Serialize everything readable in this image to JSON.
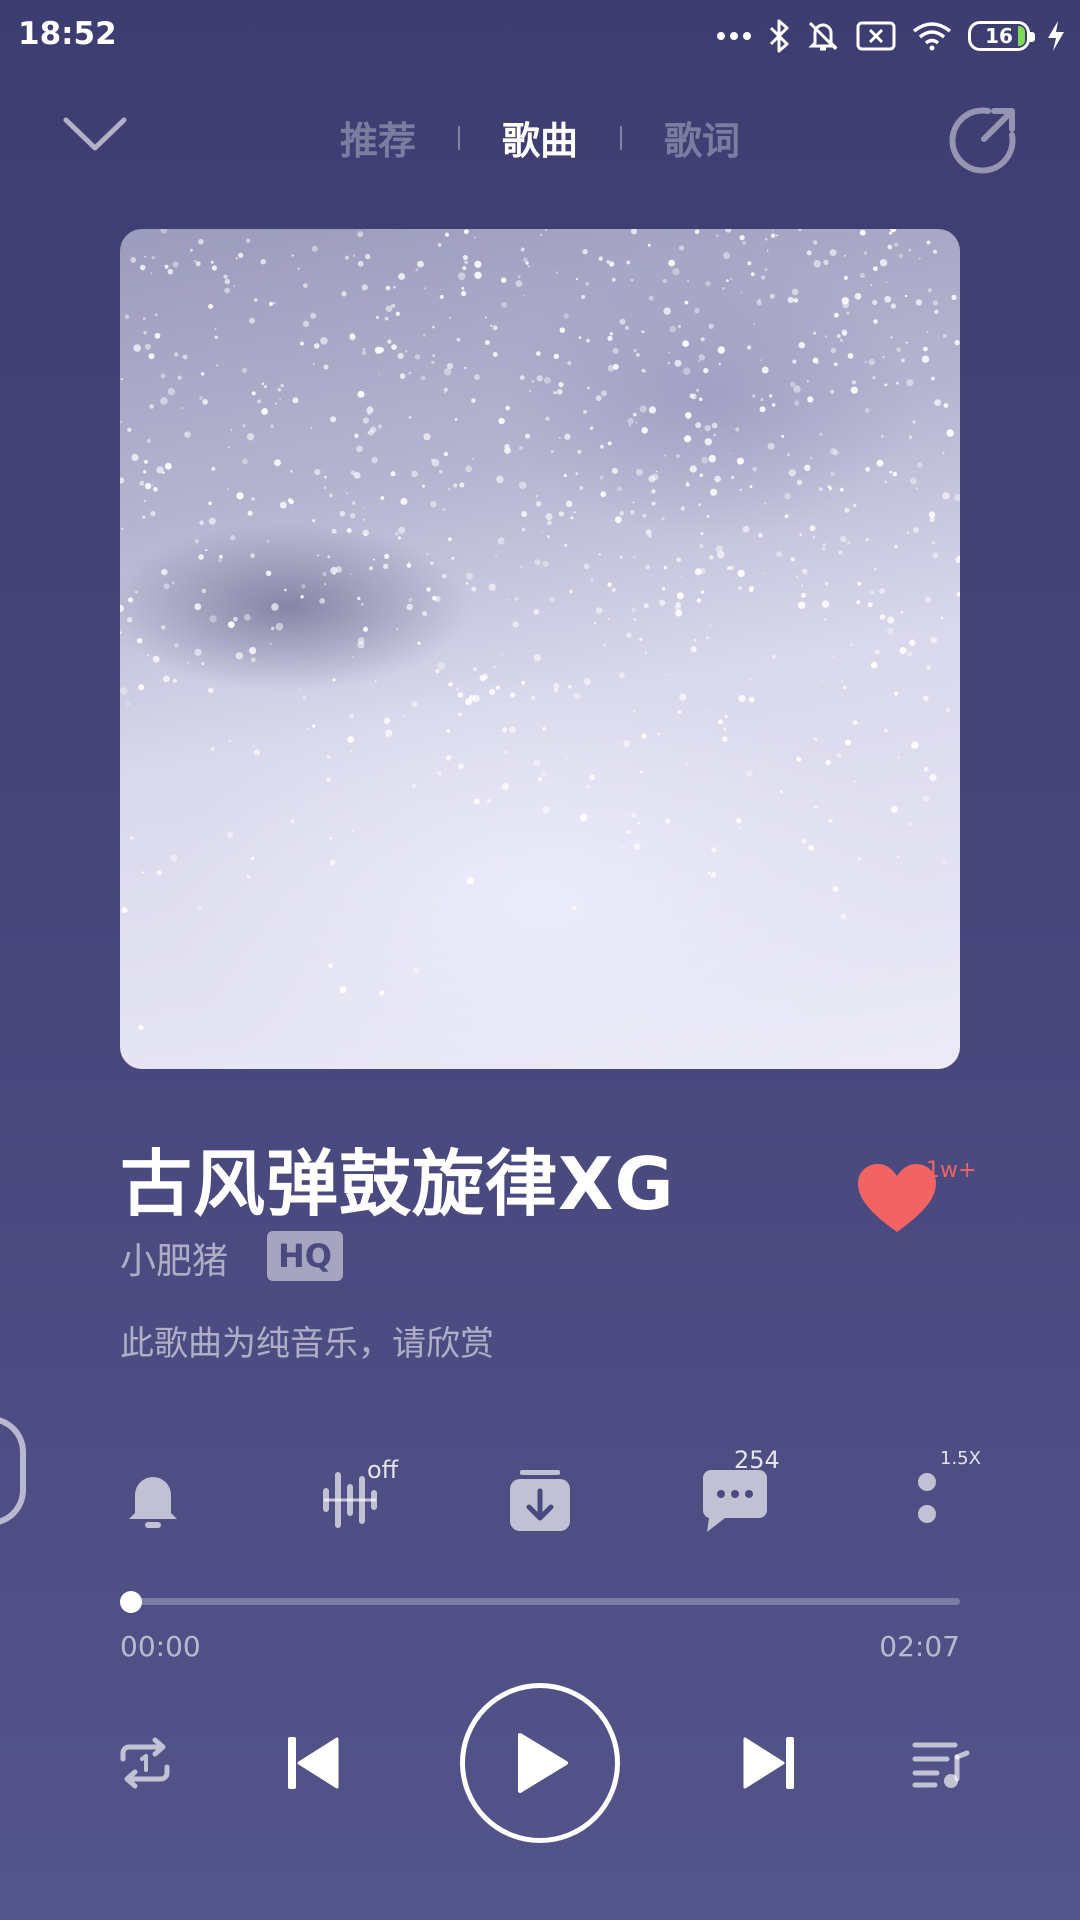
{
  "status_bar": {
    "time": "18:52",
    "battery": "16",
    "icons": [
      "more-dots-icon",
      "bluetooth-icon",
      "bell-muted-icon",
      "sim-off-icon",
      "wifi-icon",
      "battery-icon",
      "charging-bolt-icon"
    ]
  },
  "nav": {
    "tabs": [
      {
        "label": "推荐",
        "active": false
      },
      {
        "label": "歌曲",
        "active": true
      },
      {
        "label": "歌词",
        "active": false
      }
    ]
  },
  "song": {
    "title": "古风弹鼓旋律XG",
    "artist": "小肥猪",
    "quality_badge": "HQ",
    "description": "此歌曲为纯音乐，请欣赏",
    "like_count": "1w+"
  },
  "actions": {
    "effect_state": "off",
    "comment_count": "254",
    "speed": "1.5X"
  },
  "progress": {
    "current": "00:00",
    "total": "02:07",
    "fraction": 0.0
  },
  "colors": {
    "accent_heart": "#f16463",
    "background": "#454479"
  }
}
